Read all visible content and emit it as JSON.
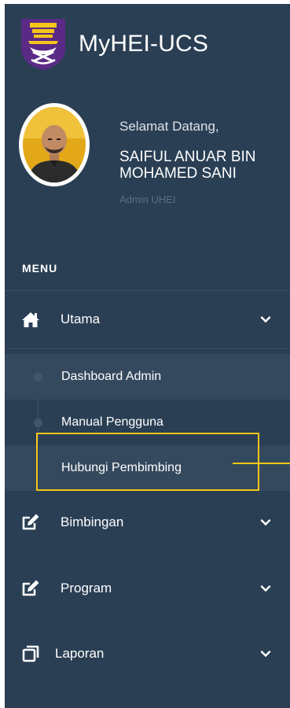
{
  "brand": {
    "title": "MyHEI-UCS",
    "logo_icon": "university-crest-logo",
    "logo_colors": [
      "#5b2a86",
      "#f5c518",
      "#ffffff"
    ]
  },
  "profile": {
    "greeting": "Selamat Datang,",
    "name": "SAIFUL ANUAR BIN MOHAMED SANI",
    "role": "Admin UHEI",
    "avatar_icon": "user-avatar-photo"
  },
  "menu": {
    "heading": "MENU",
    "items": [
      {
        "label": "Utama",
        "icon": "home-icon",
        "expanded": true,
        "children": [
          {
            "label": "Dashboard Admin"
          },
          {
            "label": "Manual Pengguna"
          },
          {
            "label": "Hubungi Pembimbing"
          }
        ]
      },
      {
        "label": "Bimbingan",
        "icon": "edit-icon",
        "expanded": false
      },
      {
        "label": "Program",
        "icon": "edit-icon",
        "expanded": false
      },
      {
        "label": "Laporan",
        "icon": "copy-icon",
        "expanded": false
      }
    ]
  },
  "colors": {
    "sidebar_bg": "#2a3f54",
    "active_item_bg": "#34495d",
    "highlight": "#f5c518"
  }
}
